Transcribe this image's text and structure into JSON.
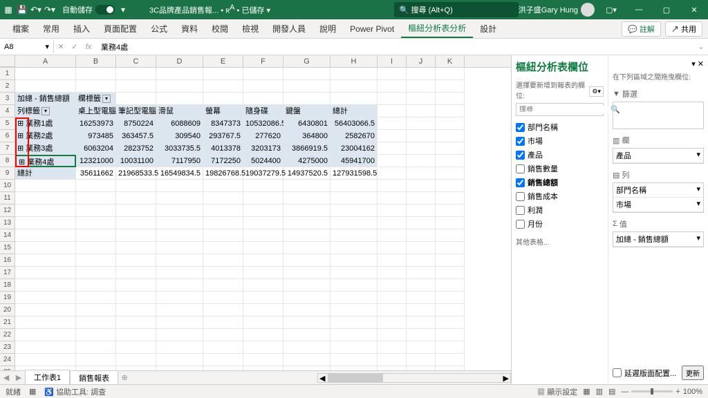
{
  "titlebar": {
    "autosave": "自動儲存",
    "on": "開啟",
    "filename": "3C品牌產品銷售報...",
    "saved": "已儲存",
    "search": "搜尋 (Alt+Q)",
    "user": "洪子盛Gary Hung"
  },
  "ribbon": {
    "tabs": [
      "檔案",
      "常用",
      "插入",
      "頁面配置",
      "公式",
      "資料",
      "校閱",
      "檢視",
      "開發人員",
      "說明",
      "Power Pivot",
      "樞紐分析表分析",
      "設計"
    ],
    "activeIdx": 11,
    "comment": "註解",
    "share": "共用"
  },
  "formula": {
    "name": "A8",
    "value": "業務4處"
  },
  "cols": [
    "A",
    "B",
    "C",
    "D",
    "E",
    "F",
    "G",
    "H",
    "I",
    "J",
    "K"
  ],
  "pivot": {
    "hdr1_a": "加總 - 銷售總額",
    "hdr1_b": "欄標籤",
    "hdr2_a": "列標籤",
    "hdr2": [
      "桌上型電腦",
      "筆記型電腦",
      "滑鼠",
      "螢幕",
      "隨身碟",
      "鍵盤",
      "總計"
    ],
    "rows": [
      {
        "l": "業務1處",
        "v": [
          "16253973",
          "8750224",
          "6088609",
          "8347373",
          "10532086.5",
          "6430801",
          "56403066.5"
        ]
      },
      {
        "l": "業務2處",
        "v": [
          "973485",
          "363457.5",
          "309540",
          "293767.5",
          "277620",
          "364800",
          "2582670"
        ]
      },
      {
        "l": "業務3處",
        "v": [
          "6063204",
          "2823752",
          "3033735.5",
          "4013378",
          "3203173",
          "3866919.5",
          "23004162"
        ]
      },
      {
        "l": "業務4處",
        "v": [
          "12321000",
          "10031100",
          "7117950",
          "7172250",
          "5024400",
          "4275000",
          "45941700"
        ]
      },
      {
        "l": "總計",
        "v": [
          "35611662",
          "21968533.5",
          "16549834.5",
          "19826768.5",
          "19037279.5",
          "14937520.5",
          "127931598.5"
        ]
      }
    ]
  },
  "side": {
    "title": "樞紐分析表欄位",
    "choose": "選擇要新增到報表的欄位:",
    "search": "搜尋",
    "fields": [
      {
        "n": "部門名稱",
        "c": true
      },
      {
        "n": "市場",
        "c": true
      },
      {
        "n": "產品",
        "c": true
      },
      {
        "n": "銷售數量",
        "c": false
      },
      {
        "n": "銷售總額",
        "c": true,
        "b": true
      },
      {
        "n": "銷售成本",
        "c": false
      },
      {
        "n": "利潤",
        "c": false
      },
      {
        "n": "月份",
        "c": false
      }
    ],
    "other": "其他表格...",
    "drag": "在下列區域之間拖曳欄位:",
    "filter": "篩選",
    "col": "欄",
    "row": "列",
    "val": "值",
    "colitems": [
      "產品"
    ],
    "rowitems": [
      "部門名稱",
      "市場"
    ],
    "valitems": [
      "加總 - 銷售總額"
    ],
    "defer": "延遲版面配置...",
    "update": "更新"
  },
  "tabs": {
    "t1": "工作表1",
    "t2": "銷售報表"
  },
  "status": {
    "ready": "就緒",
    "acc": "協助工具: 調查",
    "disp": "顯示設定",
    "zoom": "100%"
  },
  "chart_data": {
    "type": "table",
    "title": "加總 - 銷售總額",
    "row_field": "列標籤",
    "col_field": "欄標籤",
    "columns": [
      "桌上型電腦",
      "筆記型電腦",
      "滑鼠",
      "螢幕",
      "隨身碟",
      "鍵盤",
      "總計"
    ],
    "rows": [
      {
        "label": "業務1處",
        "values": [
          16253973,
          8750224,
          6088609,
          8347373,
          10532086.5,
          6430801,
          56403066.5
        ]
      },
      {
        "label": "業務2處",
        "values": [
          973485,
          363457.5,
          309540,
          293767.5,
          277620,
          364800,
          2582670
        ]
      },
      {
        "label": "業務3處",
        "values": [
          6063204,
          2823752,
          3033735.5,
          4013378,
          3203173,
          3866919.5,
          23004162
        ]
      },
      {
        "label": "業務4處",
        "values": [
          12321000,
          10031100,
          7117950,
          7172250,
          5024400,
          4275000,
          45941700
        ]
      },
      {
        "label": "總計",
        "values": [
          35611662,
          21968533.5,
          16549834.5,
          19826768.5,
          19037279.5,
          14937520.5,
          127931598.5
        ]
      }
    ]
  }
}
